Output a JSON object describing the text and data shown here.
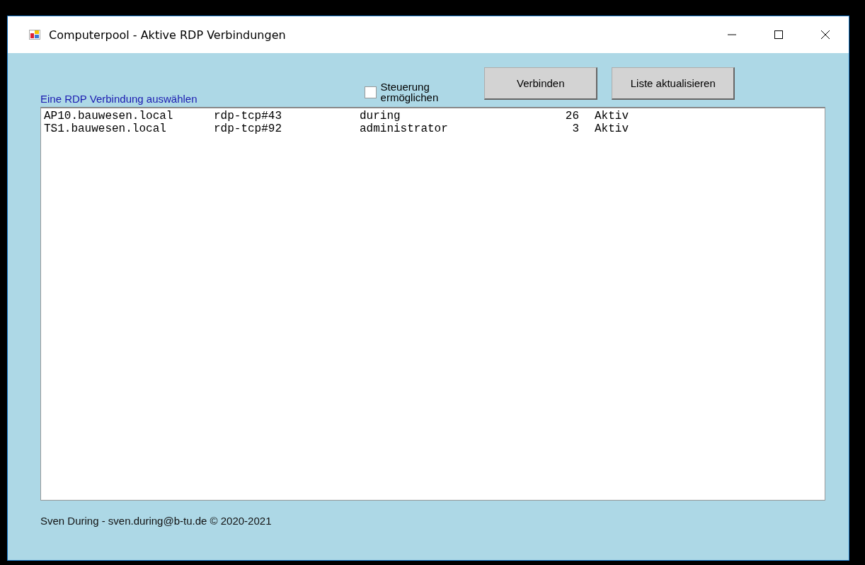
{
  "window": {
    "title": "Computerpool - Aktive RDP Verbindungen"
  },
  "label": "Eine RDP Verbindung auswählen",
  "checkbox": {
    "label_line1": "Steuerung",
    "label_line2": "ermöglichen",
    "checked": false
  },
  "buttons": [
    "Verbinden",
    "Liste aktualisieren"
  ],
  "list": [
    {
      "host": "AP10.bauwesen.local",
      "session": "rdp-tcp#43",
      "user": "during",
      "id": "26",
      "state": "Aktiv",
      "selected": false
    },
    {
      "host": "TS1.bauwesen.local",
      "session": "rdp-tcp#92",
      "user": "administrator",
      "id": "3",
      "state": "Aktiv",
      "selected": false
    }
  ],
  "footer": "Sven During - sven.during@b-tu.de © 2020-2021"
}
